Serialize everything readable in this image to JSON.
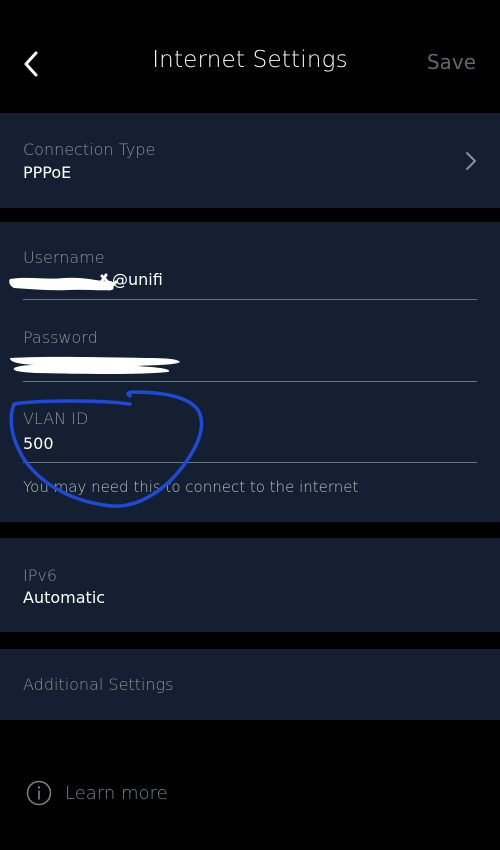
{
  "header": {
    "title": "Internet Settings",
    "save_label": "Save",
    "back_icon": "chevron-left-icon"
  },
  "connection_type": {
    "label": "Connection Type",
    "value": "PPPoE",
    "icon": "chevron-right-icon"
  },
  "credentials": {
    "username_label": "Username",
    "username_visible_suffix": "@unifi",
    "password_label": "Password",
    "vlan_label": "VLAN ID",
    "vlan_value": "500",
    "vlan_helper": "You may need this to connect to the internet"
  },
  "ipv6": {
    "label": "IPv6",
    "value": "Automatic"
  },
  "additional": {
    "label": "Additional Settings"
  },
  "footer": {
    "learn_more_label": "Learn more",
    "icon": "info-circle-icon"
  },
  "colors": {
    "background": "#000000",
    "card": "#142031",
    "annotation_stroke": "#1f49d8",
    "redaction": "#ffffff"
  }
}
